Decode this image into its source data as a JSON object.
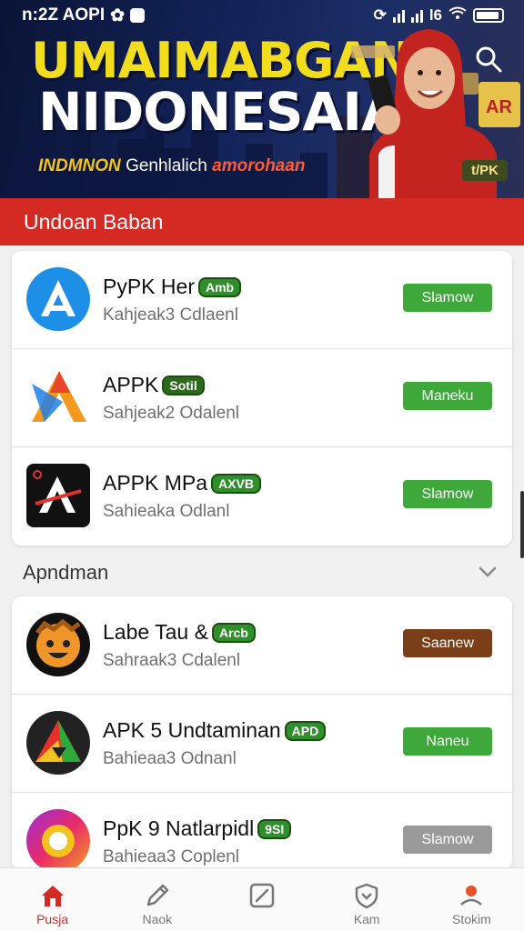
{
  "status_bar": {
    "time": "n:2Z AOPI",
    "carrier": "l6"
  },
  "hero": {
    "title_line1": "UMAIMABGAN",
    "title_line2": "NIDONESAIA",
    "subtitle_a": "INDMNON",
    "subtitle_b": "Genhlalich",
    "subtitle_c": "amorohaan",
    "promo_tag": "t/PK",
    "search_icon": "search-icon"
  },
  "section1": {
    "title": "Undoan Baban"
  },
  "apps1": [
    {
      "name": "PyPK Her",
      "badge": "Amb",
      "subtitle": "Kahjeak3 Cdlaenl",
      "button": "Slamow",
      "button_color": "#3ea83a",
      "icon": "blue-a-icon"
    },
    {
      "name": "APPK",
      "badge": "Sotil",
      "subtitle": "Sahjeak2 Odalenl",
      "button": "Maneku",
      "button_color": "#3ea83a",
      "icon": "orange-a-icon"
    },
    {
      "name": "APPK MPa",
      "badge": "AXVB",
      "subtitle": "Sahieaka Odlanl",
      "button": "Slamow",
      "button_color": "#3ea83a",
      "icon": "black-a-icon"
    }
  ],
  "section2": {
    "title": "Apndman",
    "chevron_icon": "chevron-down-icon"
  },
  "apps2": [
    {
      "name": "Labe Tau &",
      "badge": "Arcb",
      "subtitle": "Sahraak3 Cdalenl",
      "button": "Saanew",
      "button_color": "#7a3e19",
      "icon": "face-icon"
    },
    {
      "name": "APK 5 Undtaminan",
      "badge": "APD",
      "subtitle": "Bahieaa3 Odnanl",
      "button": "Naneu",
      "button_color": "#3ea83a",
      "icon": "triangle-icon"
    },
    {
      "name": "PpK 9 Natlarpidl",
      "badge": "9SI",
      "subtitle": "Bahieaa3 Coplenl",
      "button": "Slamow",
      "button_color": "#9a9a9a",
      "icon": "ring-icon"
    }
  ],
  "bottom_nav": [
    {
      "label": "Pusja",
      "icon": "home-icon",
      "active": true
    },
    {
      "label": "Naok",
      "icon": "pencil-icon",
      "active": false
    },
    {
      "label": "",
      "icon": "edit-square-icon",
      "active": false
    },
    {
      "label": "Kam",
      "icon": "shield-heart-icon",
      "active": false
    },
    {
      "label": "Stokim",
      "icon": "profile-icon",
      "active": false
    }
  ],
  "colors": {
    "brand_red": "#d42a24",
    "green": "#3ea83a",
    "title_yellow": "#f2dc1e"
  }
}
